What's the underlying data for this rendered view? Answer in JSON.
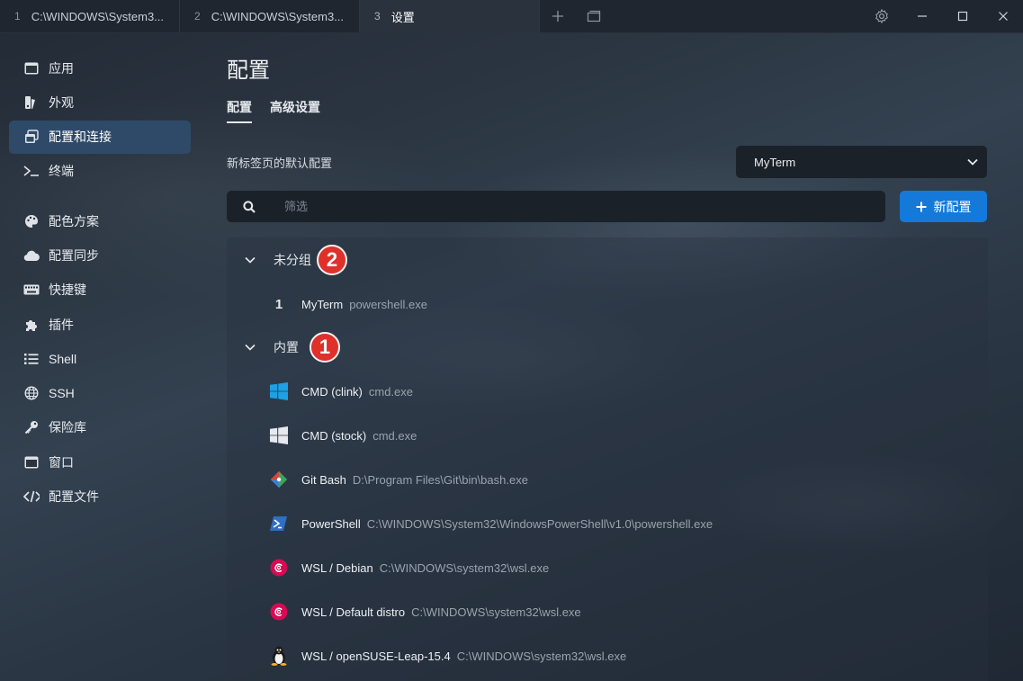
{
  "tabs": [
    {
      "num": "1",
      "label": "C:\\WINDOWS\\System3..."
    },
    {
      "num": "2",
      "label": "C:\\WINDOWS\\System3..."
    },
    {
      "num": "3",
      "label": "设置"
    }
  ],
  "sidebar": {
    "items": [
      {
        "label": "应用",
        "icon": "window-icon"
      },
      {
        "label": "外观",
        "icon": "palette-brush-icon"
      },
      {
        "label": "配置和连接",
        "icon": "profiles-icon",
        "active": true
      },
      {
        "label": "终端",
        "icon": "terminal-icon"
      },
      {
        "label": "配色方案",
        "icon": "palette-icon"
      },
      {
        "label": "配置同步",
        "icon": "cloud-icon"
      },
      {
        "label": "快捷键",
        "icon": "keyboard-icon"
      },
      {
        "label": "插件",
        "icon": "puzzle-icon"
      },
      {
        "label": "Shell",
        "icon": "list-icon"
      },
      {
        "label": "SSH",
        "icon": "globe-icon"
      },
      {
        "label": "保险库",
        "icon": "key-icon"
      },
      {
        "label": "窗口",
        "icon": "window-icon"
      },
      {
        "label": "配置文件",
        "icon": "code-icon"
      }
    ]
  },
  "main": {
    "title": "配置",
    "subtabs": [
      {
        "label": "配置",
        "active": true
      },
      {
        "label": "高级设置"
      }
    ],
    "default_profile_label": "新标签页的默认配置",
    "default_profile_value": "MyTerm",
    "search_placeholder": "筛选",
    "new_button_label": "新配置",
    "groups": [
      {
        "label": "未分组",
        "badge": "2",
        "profiles": [
          {
            "index": "1",
            "name": "MyTerm",
            "path": "powershell.exe"
          }
        ]
      },
      {
        "label": "内置",
        "badge": "1",
        "profiles": [
          {
            "name": "CMD (clink)",
            "path": "cmd.exe",
            "icon": "windows-logo-icon"
          },
          {
            "name": "CMD (stock)",
            "path": "cmd.exe",
            "icon": "windows-logo-icon"
          },
          {
            "name": "Git Bash",
            "path": "D:\\Program Files\\Git\\bin\\bash.exe",
            "icon": "git-icon"
          },
          {
            "name": "PowerShell",
            "path": "C:\\WINDOWS\\System32\\WindowsPowerShell\\v1.0\\powershell.exe",
            "icon": "powershell-icon"
          },
          {
            "name": "WSL / Debian",
            "path": "C:\\WINDOWS\\system32\\wsl.exe",
            "icon": "debian-icon"
          },
          {
            "name": "WSL / Default distro",
            "path": "C:\\WINDOWS\\system32\\wsl.exe",
            "icon": "debian-icon"
          },
          {
            "name": "WSL / openSUSE-Leap-15.4",
            "path": "C:\\WINDOWS\\system32\\wsl.exe",
            "icon": "linux-penguin-icon"
          }
        ]
      }
    ]
  },
  "colors": {
    "accent": "#1479d8",
    "active_sidebar": "#2e4a68",
    "badge_red": "#e0302a",
    "windows_blue": "#1da1e4",
    "powershell_blue": "#2f6fc4",
    "debian_red": "#d70a53"
  }
}
